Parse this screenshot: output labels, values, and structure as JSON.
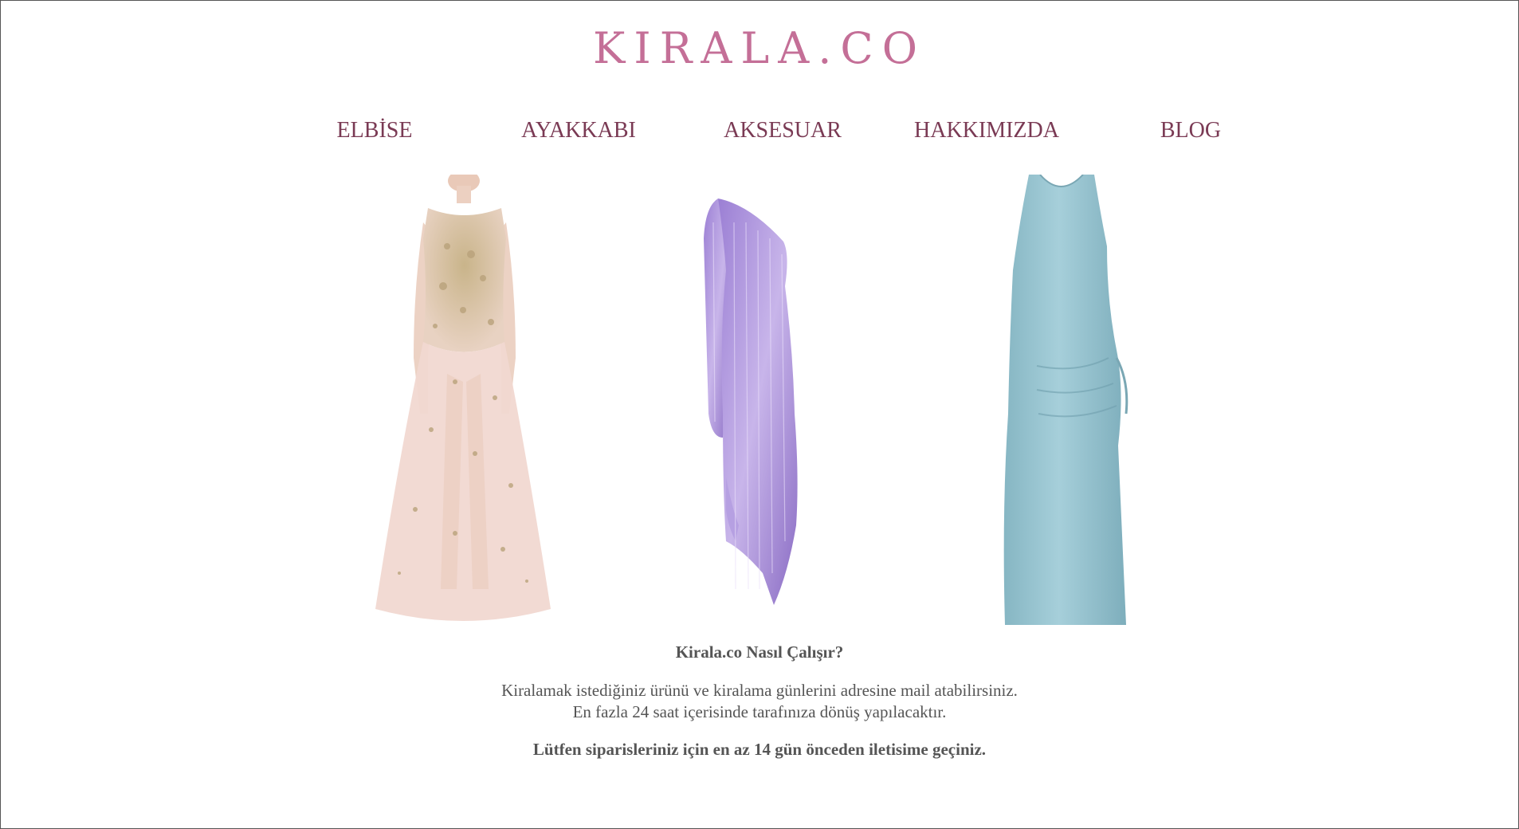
{
  "site": {
    "logo_text": "KIRALA.CO",
    "brand_color": "#c46f97",
    "nav_color": "#7a3a54"
  },
  "nav": {
    "items": [
      {
        "label": "ELBİSE"
      },
      {
        "label": "AYAKKABI"
      },
      {
        "label": "AKSESUAR"
      },
      {
        "label": "HAKKIMIZDA"
      },
      {
        "label": "BLOG"
      }
    ]
  },
  "products": [
    {
      "name": "embellished-tulle-gown",
      "color": "#e9cfc6"
    },
    {
      "name": "purple-sequin-one-shoulder-dress",
      "color": "#a88ad6"
    },
    {
      "name": "light-blue-satin-midi-dress",
      "color": "#8fbcc9"
    }
  ],
  "info": {
    "title": "Kirala.co Nasıl Çalışır?",
    "line1": "Kiralamak istediğiniz ürünü ve kiralama günlerini adresine mail atabilirsiniz.",
    "line2": "En fazla 24 saat içerisinde tarafınıza dönüş yapılacaktır.",
    "note": "Lütfen siparisleriniz için en az 14 gün önceden iletisime geçiniz."
  }
}
